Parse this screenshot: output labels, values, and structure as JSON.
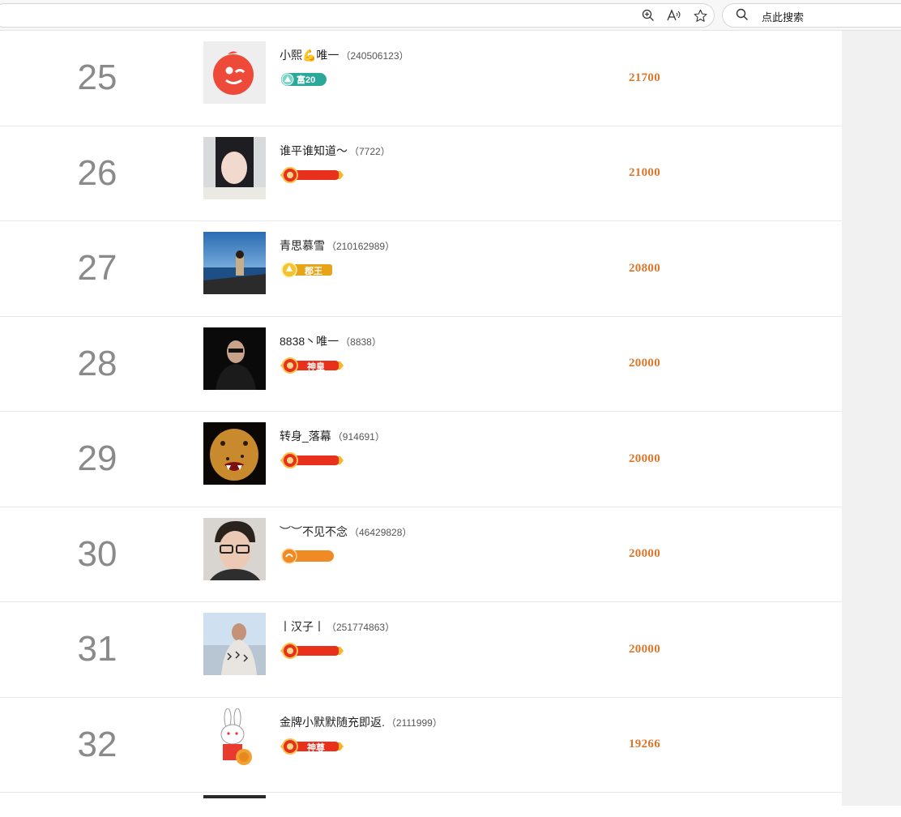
{
  "browser": {
    "search_placeholder": "点此搜索",
    "icons": [
      "zoom-in-icon",
      "read-aloud-icon",
      "favorite-star-icon",
      "search-icon"
    ]
  },
  "rows": [
    {
      "rank": "25",
      "name": "小熙💪唯一",
      "uid": "（240506123）",
      "badge_text": "富20",
      "badge_type": "teal",
      "score": "21700",
      "avatar": "red-logo"
    },
    {
      "rank": "26",
      "name": "谁平谁知道～",
      "uid": "（7722）",
      "badge_text": "",
      "badge_type": "red",
      "score": "21000",
      "avatar": "girl-photo"
    },
    {
      "rank": "27",
      "name": "青思慕雪",
      "uid": "（210162989）",
      "badge_text": "郡王",
      "badge_type": "gold",
      "score": "20800",
      "avatar": "boat-photo"
    },
    {
      "rank": "28",
      "name": "8838丶唯一",
      "uid": "（8838）",
      "badge_text": "神皇",
      "badge_type": "red",
      "score": "20000",
      "avatar": "man-dark-photo"
    },
    {
      "rank": "29",
      "name": "转身_落幕",
      "uid": "（914691）",
      "badge_text": "",
      "badge_type": "red",
      "score": "20000",
      "avatar": "leopard-photo"
    },
    {
      "rank": "30",
      "name": "︶︶不见不念",
      "uid": "（46429828）",
      "badge_text": "",
      "badge_type": "orange",
      "score": "20000",
      "avatar": "glasses-man-photo"
    },
    {
      "rank": "31",
      "name": "丨汉子丨",
      "uid": "（251774863）",
      "badge_text": "",
      "badge_type": "red",
      "score": "20000",
      "avatar": "beach-man-photo"
    },
    {
      "rank": "32",
      "name": "金牌小默默随充即返.",
      "uid": "（2111999）",
      "badge_text": "神尊",
      "badge_type": "red",
      "score": "19266",
      "avatar": "rabbit-cartoon"
    }
  ],
  "colors": {
    "score": "#d9762a",
    "rank": "#8a8a8a",
    "badge_red": "#e8301c",
    "badge_gold": "#e8a418",
    "badge_teal": "#2aa89a",
    "badge_orange": "#f08a24"
  }
}
